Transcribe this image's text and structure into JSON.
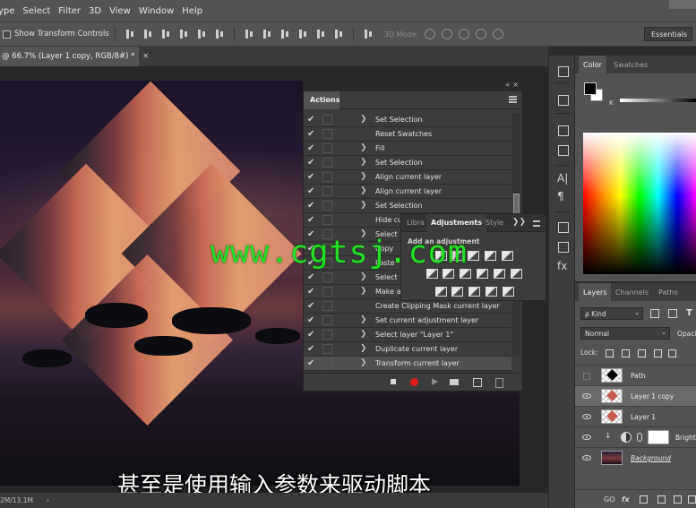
{
  "menubar": {
    "items": [
      "ype",
      "Select",
      "Filter",
      "3D",
      "View",
      "Window",
      "Help"
    ]
  },
  "options": {
    "show_transform_label": "Show Transform Controls",
    "mode_3d_label": "3D Mode:",
    "workspace": "Essentials"
  },
  "document": {
    "tab_title": "@ 66.7% (Layer 1 copy, RGB/8#) *",
    "tab_close": "×",
    "status": "2M/13.1M",
    "status_arrow": "›"
  },
  "actions_panel": {
    "panel_collapse": "«",
    "panel_close": "×",
    "tab": "Actions",
    "rows": [
      {
        "label": "Set Selection"
      },
      {
        "label": "Reset Swatches"
      },
      {
        "label": "Fill"
      },
      {
        "label": "Set Selection"
      },
      {
        "label": "Align current layer"
      },
      {
        "label": "Align current layer"
      },
      {
        "label": "Set Selection"
      },
      {
        "label": "Hide cu"
      },
      {
        "label": "Select la"
      },
      {
        "label": "Copy"
      },
      {
        "label": "Paste"
      },
      {
        "label": "Select la"
      },
      {
        "label": "Make ad"
      },
      {
        "label": "Create Clipping Mask current layer"
      },
      {
        "label": "Set current adjustment layer"
      },
      {
        "label": "Select layer \"Layer 1\""
      },
      {
        "label": "Duplicate current layer"
      },
      {
        "label": "Transform current layer"
      }
    ],
    "check": "✔",
    "expand": "❯"
  },
  "adjustments_panel": {
    "tabs": [
      "Libra",
      "Adjustments",
      "Style"
    ],
    "expand": "❯❯",
    "add_label": "Add an adjustment"
  },
  "color_panel": {
    "tabs": [
      "Color",
      "Swatches"
    ],
    "k_label": "K"
  },
  "layers_panel": {
    "tabs": [
      "Layers",
      "Channels",
      "Paths"
    ],
    "kind_label": "ρ Kind",
    "blend_mode": "Normal",
    "opacity_label": "Opaci",
    "lock_label": "Lock:",
    "layers": [
      {
        "name": "Path"
      },
      {
        "name": "Layer 1 copy"
      },
      {
        "name": "Layer 1"
      },
      {
        "name": "Brightn"
      },
      {
        "name": "Background"
      }
    ],
    "bottom_icons": [
      "GO",
      "fx"
    ]
  },
  "overlay": {
    "subtitle": "甚至是使用输入参数来驱动脚本",
    "watermark": "www.cgtsj.com"
  }
}
